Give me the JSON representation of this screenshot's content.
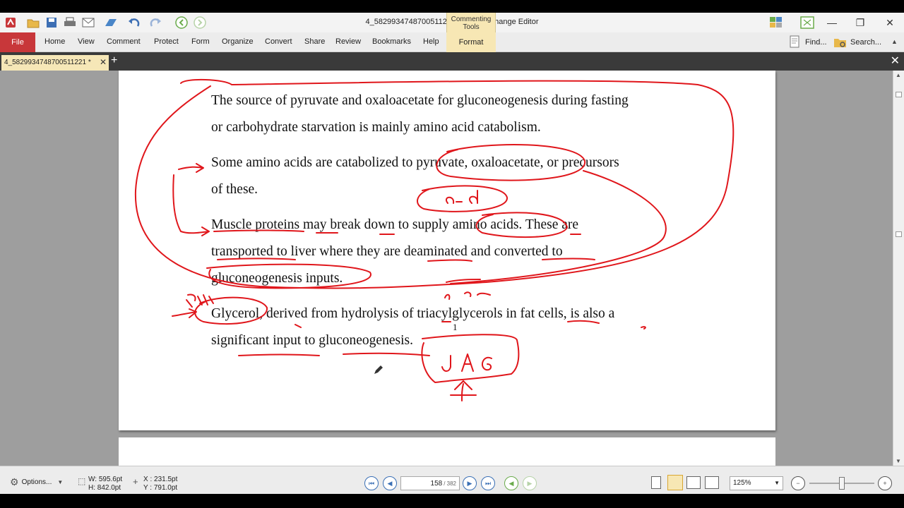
{
  "window": {
    "title": "4_5829934748700511221* - PDF-XChange Editor",
    "context_tab": "Commenting Tools",
    "minimize": "—",
    "restore": "❐",
    "close": "✕"
  },
  "menu": {
    "file": "File",
    "items": [
      "Home",
      "View",
      "Comment",
      "Protect",
      "Form",
      "Organize",
      "Convert",
      "Share",
      "Review",
      "Bookmarks",
      "Help"
    ],
    "format": "Format",
    "find": "Find...",
    "search": "Search..."
  },
  "tabs": {
    "doc_tab": "4_5829934748700511221 *",
    "close": "✕",
    "new": "+"
  },
  "document": {
    "lines": [
      "The source of pyruvate and oxaloacetate for gluconeogenesis during fasting",
      "or carbohydrate starvation is mainly amino acid catabolism.",
      "Some amino acids are catabolized to pyruvate, oxaloacetate, or precursors",
      "of these.",
      "Muscle proteins may break down to supply amino acids. These are",
      "transported to liver where they are deaminated and converted to",
      "gluconeogenesis inputs.",
      "Glycerol, derived from hydrolysis of triacylglycerols in fat cells, is also a",
      "significant input to gluconeogenesis."
    ],
    "footnote_marker": "1"
  },
  "status": {
    "options": "Options...",
    "width": "W: 595.6pt",
    "height": "H: 842.0pt",
    "x": "X : 231.5pt",
    "y": "Y : 791.0pt",
    "page_current": "158",
    "page_total": "/ 382",
    "zoom": "125%"
  },
  "colors": {
    "accent_red": "#c8373a",
    "context_yellow": "#f7e7b4",
    "ink_red": "#e0161b"
  }
}
